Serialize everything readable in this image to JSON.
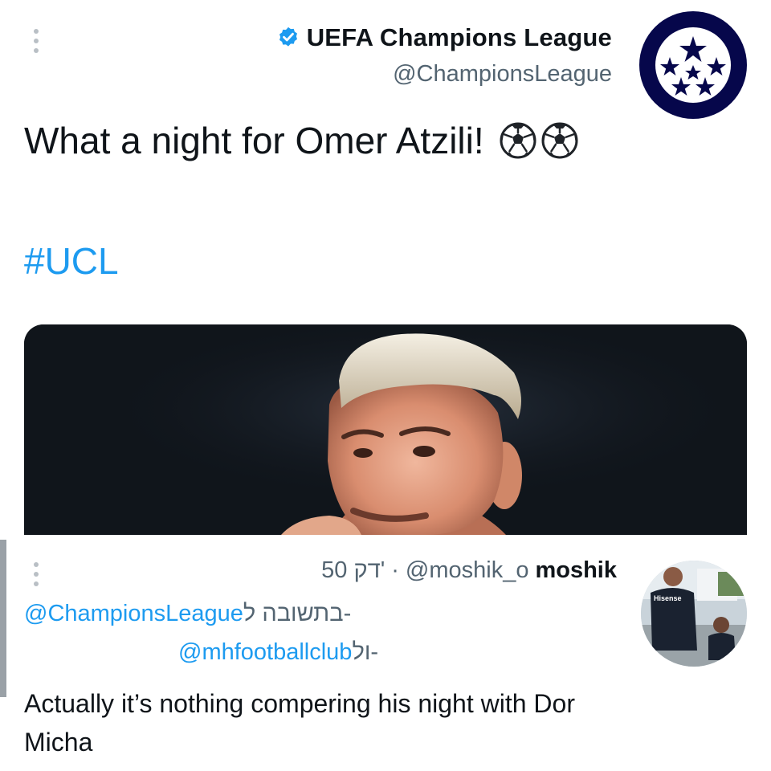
{
  "tweet": {
    "author_name": "UEFA Champions League",
    "author_handle": "@ChampionsLeague",
    "verified_icon": "verified-badge-icon",
    "text": "What a night for Omer Atzili!",
    "emoji": [
      "soccer-ball-icon",
      "soccer-ball-icon"
    ],
    "hashtag": "#UCL",
    "media_description_icon": "player-photo"
  },
  "reply": {
    "time": "50 דק'",
    "separator": "·",
    "handle": "@moshik_o",
    "name": "moshik",
    "replying_prefix": "בתשובה ל-",
    "replying_to_1": "@ChampionsLeague",
    "replying_to_2_prefix": "ול-",
    "replying_to_2": "@mhfootballclub",
    "text": "Actually it’s nothing compering his night with Dor Micha"
  },
  "colors": {
    "link": "#1d9bf0",
    "muted": "#536471",
    "text": "#0f1419",
    "ucl_navy": "#06074b"
  }
}
